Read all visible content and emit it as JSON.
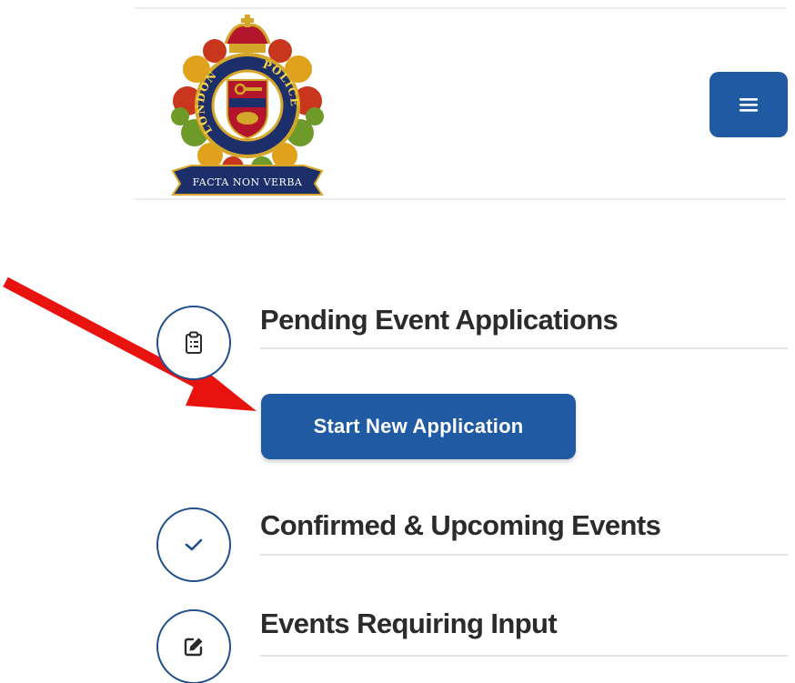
{
  "header": {
    "logo": {
      "ring_left": "LONDON",
      "ring_right": "POLICE",
      "motto": "FACTA NON VERBA"
    },
    "menu_icon": "hamburger-icon"
  },
  "sections": [
    {
      "title": "Pending Event Applications",
      "icon": "clipboard-list-icon"
    },
    {
      "title": "Confirmed & Upcoming Events",
      "icon": "check-icon"
    },
    {
      "title": "Events Requiring Input",
      "icon": "edit-icon"
    }
  ],
  "actions": {
    "start_new_application": "Start New Application"
  },
  "annotation": {
    "arrow_color": "#e8130f"
  },
  "colors": {
    "primary": "#1f5aa3",
    "icon_border": "#1f4f8c",
    "title_text": "#2b2b2b"
  }
}
